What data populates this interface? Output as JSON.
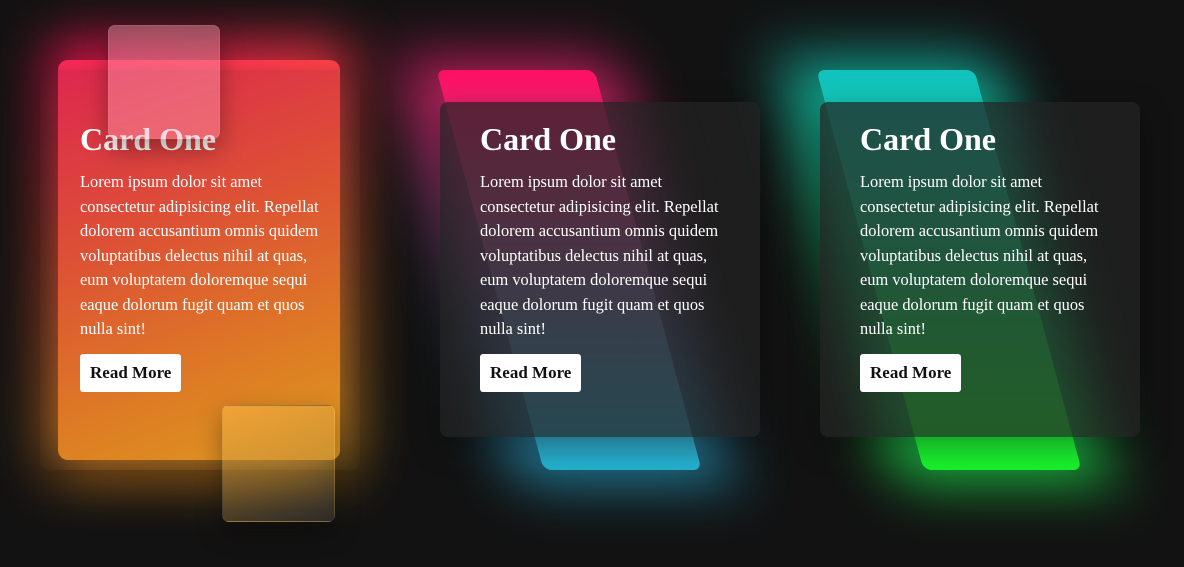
{
  "cards": [
    {
      "title": "Card One",
      "text": "Lorem ipsum dolor sit amet consectetur adipisicing elit. Repellat dolorem accusantium omnis quidem voluptatibus delectus nihil at quas, eum voluptatem doloremque sequi eaque dolorum fugit quam et quos nulla sint!",
      "button": "Read More",
      "accent": "#ff4a3e"
    },
    {
      "title": "Card One",
      "text": "Lorem ipsum dolor sit amet consectetur adipisicing elit. Repellat dolorem accusantium omnis quidem voluptatibus delectus nihil at quas, eum voluptatem doloremque sequi eaque dolorum fugit quam et quos nulla sint!",
      "button": "Read More",
      "accent": "#ff0f63"
    },
    {
      "title": "Card One",
      "text": "Lorem ipsum dolor sit amet consectetur adipisicing elit. Repellat dolorem accusantium omnis quidem voluptatibus delectus nihil at quas, eum voluptatem doloremque sequi eaque dolorum fugit quam et quos nulla sint!",
      "button": "Read More",
      "accent": "#18f22a"
    }
  ],
  "colors": {
    "background": "#121212",
    "card1_gradient": [
      "#ff285a",
      "#ff8e26",
      "#ffae22"
    ],
    "card2_gradient": [
      "#ff0f63",
      "#22b2d0"
    ],
    "card3_gradient": [
      "#11c2c0",
      "#18f22a"
    ]
  }
}
